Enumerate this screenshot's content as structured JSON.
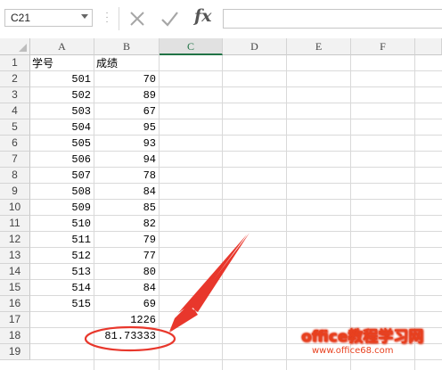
{
  "formula_bar": {
    "name_box": "C21",
    "formula": "",
    "fx_label": "fx"
  },
  "columns": [
    "A",
    "B",
    "C",
    "D",
    "E",
    "F"
  ],
  "selected_column": "C",
  "rows": [
    "1",
    "2",
    "3",
    "4",
    "5",
    "6",
    "7",
    "8",
    "9",
    "10",
    "11",
    "12",
    "13",
    "14",
    "15",
    "16",
    "17",
    "18",
    "19"
  ],
  "cells": {
    "A1": "学号",
    "B1": "成绩",
    "A2": "501",
    "B2": "70",
    "A3": "502",
    "B3": "89",
    "A4": "503",
    "B4": "67",
    "A5": "504",
    "B5": "95",
    "A6": "505",
    "B6": "93",
    "A7": "506",
    "B7": "94",
    "A8": "507",
    "B8": "78",
    "A9": "508",
    "B9": "84",
    "A10": "509",
    "B10": "85",
    "A11": "510",
    "B11": "82",
    "A12": "511",
    "B12": "79",
    "A13": "512",
    "B13": "77",
    "A14": "513",
    "B14": "80",
    "A15": "514",
    "B15": "84",
    "A16": "515",
    "B16": "69",
    "B17": "1226",
    "B18": "81.73333"
  },
  "watermark": {
    "line1": "office教程学习网",
    "line2": "www.office68.com"
  },
  "annotation_color": "#e8372c",
  "selection_color": "#217346"
}
